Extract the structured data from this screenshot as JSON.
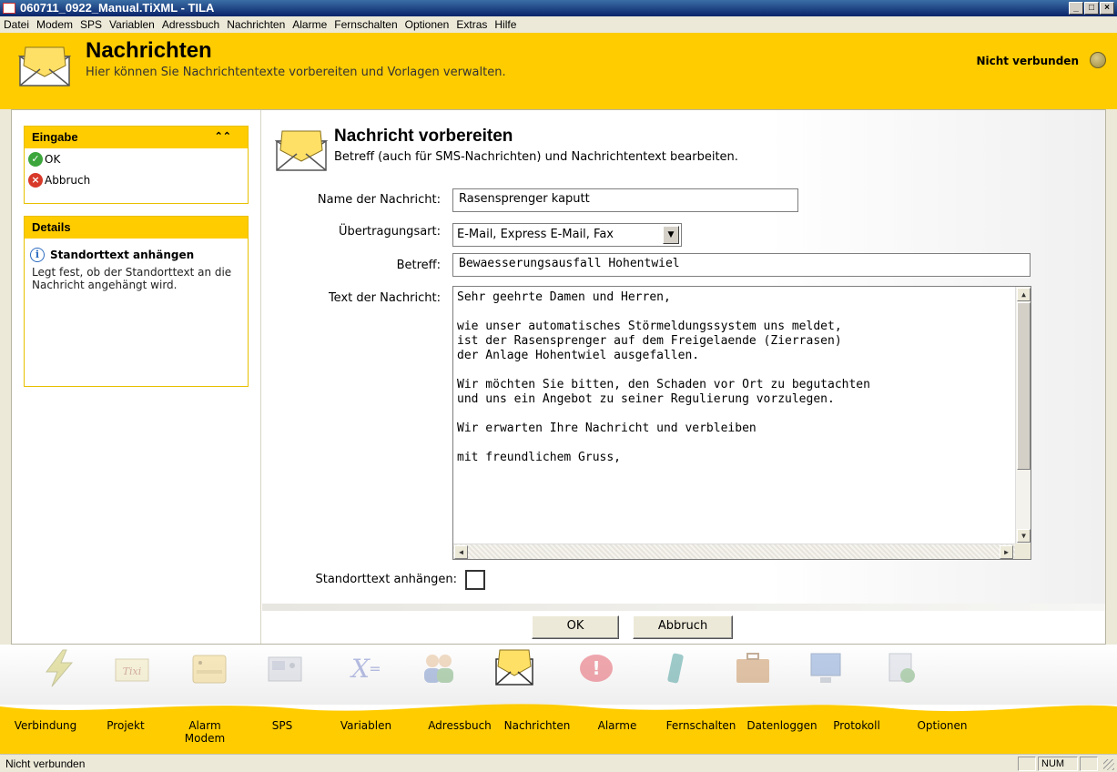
{
  "window": {
    "title": "060711_0922_Manual.TiXML - TILA",
    "min": "_",
    "max": "□",
    "close": "×"
  },
  "menu": [
    "Datei",
    "Modem",
    "SPS",
    "Variablen",
    "Adressbuch",
    "Nachrichten",
    "Alarme",
    "Fernschalten",
    "Optionen",
    "Extras",
    "Hilfe"
  ],
  "header": {
    "title": "Nachrichten",
    "subtitle": "Hier können Sie Nachrichtentexte vorbereiten und Vorlagen verwalten.",
    "connection": "Nicht verbunden"
  },
  "sidebar": {
    "eingabe": {
      "title": "Eingabe",
      "collapse": "»",
      "ok": "OK",
      "cancel": "Abbruch"
    },
    "details": {
      "title": "Details",
      "item_title": "Standorttext anhängen",
      "item_text": "Legt fest, ob der Standorttext an die Nachricht angehängt wird."
    }
  },
  "form": {
    "title": "Nachricht vorbereiten",
    "subtitle": "Betreff (auch für SMS-Nachrichten) und Nachrichtentext bearbeiten.",
    "name_label": "Name der Nachricht:",
    "name_value": "Rasensprenger kaputt",
    "transfer_label": "Übertragungsart:",
    "transfer_value": "E-Mail, Express E-Mail, Fax",
    "subject_label": "Betreff:",
    "subject_value": "Bewaesserungsausfall Hohentwiel",
    "text_label": "Text der Nachricht:",
    "text_lines": [
      "Sehr geehrte Damen und Herren,",
      "",
      "wie unser automatisches Störmeldungssystem uns meldet,",
      "ist der Rasensprenger auf dem Freigelaende (Zierrasen)",
      "der Anlage Hohentwiel ausgefallen.",
      "",
      "Wir möchten Sie bitten, den Schaden vor Ort zu begutachten",
      "und uns ein Angebot zu seiner Regulierung vorzulegen.",
      "",
      "Wir erwarten Ihre Nachricht und verbleiben",
      "",
      "mit freundlichem Gruss,"
    ],
    "location_label": "Standorttext anhängen:",
    "location_checked": false,
    "ok_button": "OK",
    "cancel_button": "Abbruch"
  },
  "toolbar": [
    {
      "label": "Verbindung",
      "icon": "lightning-icon"
    },
    {
      "label": "Projekt",
      "icon": "tixi-icon"
    },
    {
      "label": "Alarm\nModem",
      "icon": "modem-icon"
    },
    {
      "label": "SPS",
      "icon": "sps-icon"
    },
    {
      "label": "Variablen",
      "icon": "variables-icon"
    },
    {
      "label": "Adressbuch",
      "icon": "people-icon"
    },
    {
      "label": "Nachrichten",
      "icon": "envelope-icon"
    },
    {
      "label": "Alarme",
      "icon": "alarm-icon"
    },
    {
      "label": "Fernschalten",
      "icon": "remote-switch-icon"
    },
    {
      "label": "Datenloggen",
      "icon": "briefcase-icon"
    },
    {
      "label": "Protokoll",
      "icon": "monitor-icon"
    },
    {
      "label": "Optionen",
      "icon": "options-icon"
    }
  ],
  "status": {
    "text": "Nicht verbunden",
    "num": "NUM"
  },
  "colors": {
    "accent": "#ffcc00",
    "titlebar": "#0a246a"
  }
}
